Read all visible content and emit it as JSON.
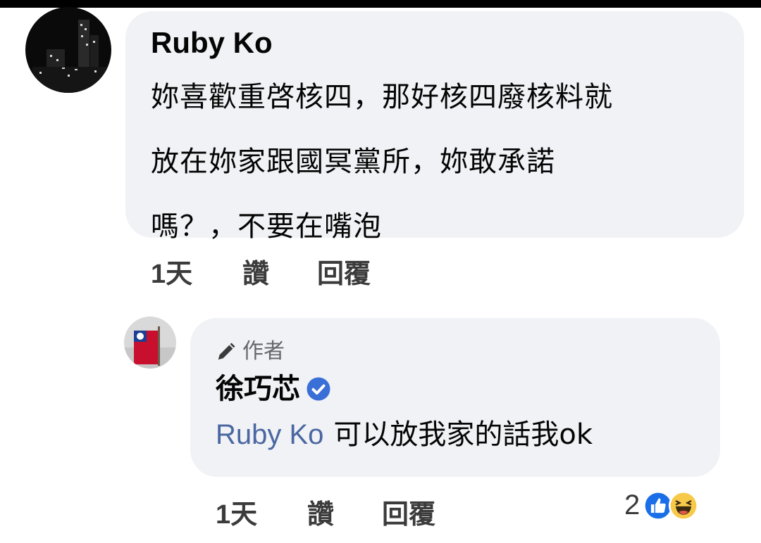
{
  "comment1": {
    "author": "Ruby Ko",
    "text": "妳喜歡重啓核四，那好核四廢核料就\n放在妳家跟國冥黨所，妳敢承諾\n嗎？，不要在嘴泡",
    "timestamp": "1天",
    "like_label": "讚",
    "reply_label": "回覆"
  },
  "comment2": {
    "badge": "作者",
    "author": "徐巧芯",
    "mention": "Ruby Ko",
    "text": "可以放我家的話我ok",
    "timestamp": "1天",
    "like_label": "讚",
    "reply_label": "回覆",
    "reaction_count": "2"
  },
  "icons": {
    "pencil": "pencil-icon",
    "verified": "verified-badge-icon",
    "like": "like-reaction-icon",
    "haha": "haha-reaction-icon"
  },
  "colors": {
    "bubble": "#f0f2f5",
    "mention": "#4b67a1",
    "verified": "#1877f2"
  }
}
